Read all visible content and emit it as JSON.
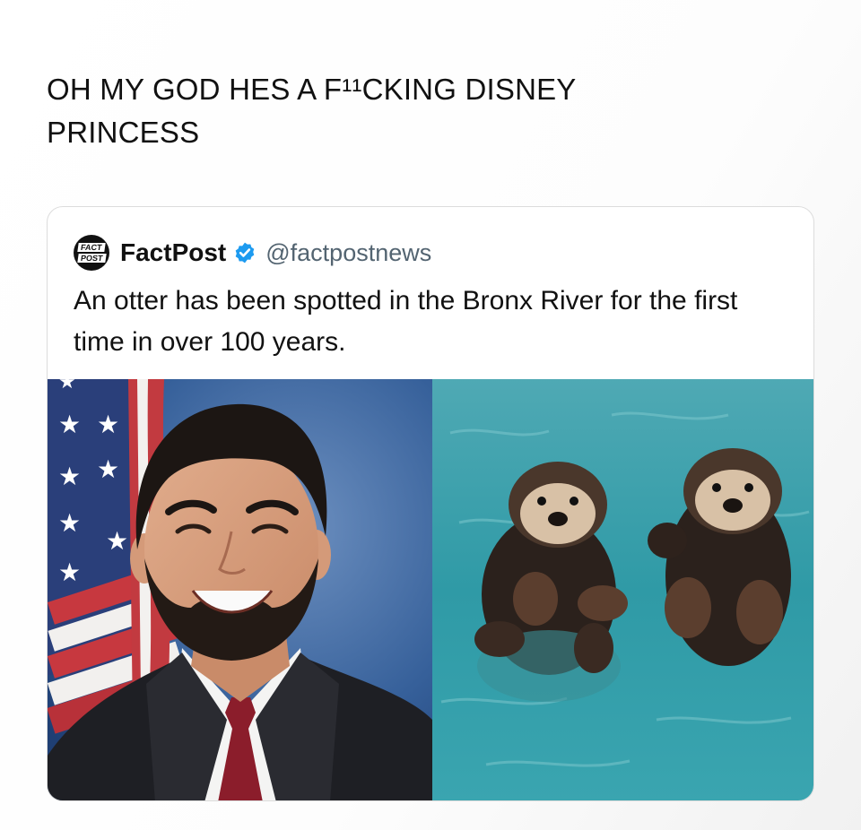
{
  "post": {
    "text_line1": "OH MY GOD HES A F¹¹CKING DISNEY",
    "text_line2": "PRINCESS"
  },
  "quote": {
    "logo_line1": "FACT",
    "logo_line2": "POST",
    "name": "FactPost",
    "handle": "@factpostnews",
    "verified_icon": "verified-badge-icon",
    "text": "An otter has been spotted in the Bronx River for the first time in over 100 years.",
    "colors": {
      "verified": "#1d9bf0",
      "handle": "#536471"
    }
  },
  "media": {
    "left": "portrait-photo",
    "right": "otters-photo"
  }
}
